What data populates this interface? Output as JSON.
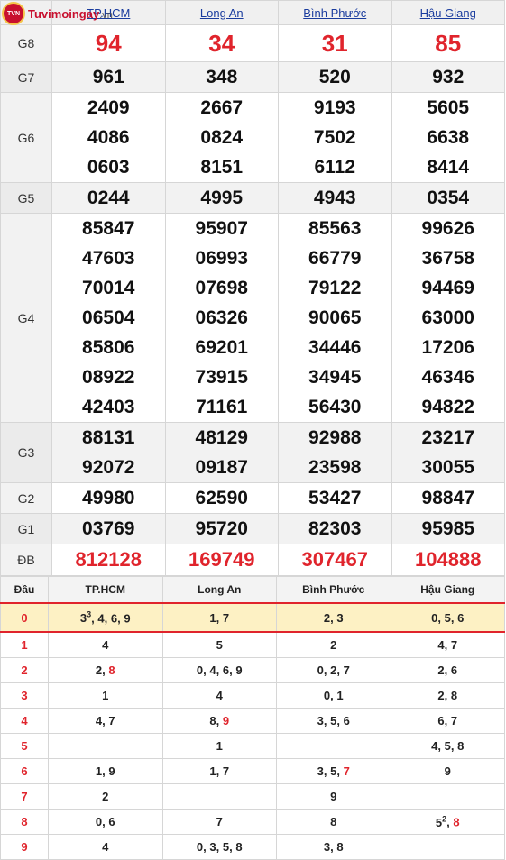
{
  "logo": {
    "badge": "TVN",
    "brand": "Tuvimoingay",
    "domain": ".vn"
  },
  "provinces": [
    "TP.HCM",
    "Long An",
    "Bình Phước",
    "Hậu Giang"
  ],
  "prizes": [
    {
      "label": "G8",
      "values": [
        [
          "94"
        ],
        [
          "34"
        ],
        [
          "31"
        ],
        [
          "85"
        ]
      ]
    },
    {
      "label": "G7",
      "values": [
        [
          "961"
        ],
        [
          "348"
        ],
        [
          "520"
        ],
        [
          "932"
        ]
      ]
    },
    {
      "label": "G6",
      "values": [
        [
          "2409",
          "4086",
          "0603"
        ],
        [
          "2667",
          "0824",
          "8151"
        ],
        [
          "9193",
          "7502",
          "6112"
        ],
        [
          "5605",
          "6638",
          "8414"
        ]
      ]
    },
    {
      "label": "G5",
      "values": [
        [
          "0244"
        ],
        [
          "4995"
        ],
        [
          "4943"
        ],
        [
          "0354"
        ]
      ]
    },
    {
      "label": "G4",
      "values": [
        [
          "85847",
          "47603",
          "70014",
          "06504",
          "85806",
          "08922",
          "42403"
        ],
        [
          "95907",
          "06993",
          "07698",
          "06326",
          "69201",
          "73915",
          "71161"
        ],
        [
          "85563",
          "66779",
          "79122",
          "90065",
          "34446",
          "34945",
          "56430"
        ],
        [
          "99626",
          "36758",
          "94469",
          "63000",
          "17206",
          "46346",
          "94822"
        ]
      ]
    },
    {
      "label": "G3",
      "values": [
        [
          "88131",
          "92072"
        ],
        [
          "48129",
          "09187"
        ],
        [
          "92988",
          "23598"
        ],
        [
          "23217",
          "30055"
        ]
      ]
    },
    {
      "label": "G2",
      "values": [
        [
          "49980"
        ],
        [
          "62590"
        ],
        [
          "53427"
        ],
        [
          "98847"
        ]
      ]
    },
    {
      "label": "G1",
      "values": [
        [
          "03769"
        ],
        [
          "95720"
        ],
        [
          "82303"
        ],
        [
          "95985"
        ]
      ]
    },
    {
      "label": "ĐB",
      "values": [
        [
          "812128"
        ],
        [
          "169749"
        ],
        [
          "307467"
        ],
        [
          "104888"
        ]
      ]
    }
  ],
  "loto": {
    "header": "Đầu",
    "rows": [
      {
        "dau": "0",
        "cells": [
          "3|3, 4, 6, 9",
          "1, 7",
          "2, 3",
          "0, 5, 6"
        ]
      },
      {
        "dau": "1",
        "cells": [
          "4",
          "5",
          "2",
          "4, 7"
        ]
      },
      {
        "dau": "2",
        "cells": [
          "2, *8",
          "0, 4, 6, 9",
          "0, 2, 7",
          "2, 6"
        ]
      },
      {
        "dau": "3",
        "cells": [
          "1",
          "4",
          "0, 1",
          "2, 8"
        ]
      },
      {
        "dau": "4",
        "cells": [
          "4, 7",
          "8, *9",
          "3, 5, 6",
          "6, 7"
        ]
      },
      {
        "dau": "5",
        "cells": [
          "",
          "1",
          "",
          "4, 5, 8"
        ]
      },
      {
        "dau": "6",
        "cells": [
          "1, 9",
          "1, 7",
          "3, 5, *7",
          "9"
        ]
      },
      {
        "dau": "7",
        "cells": [
          "2",
          "",
          "9",
          ""
        ]
      },
      {
        "dau": "8",
        "cells": [
          "0, 6",
          "7",
          "8",
          "5|2, *8"
        ]
      },
      {
        "dau": "9",
        "cells": [
          "4",
          "0, 3, 5, 8",
          "3, 8",
          ""
        ]
      }
    ]
  }
}
